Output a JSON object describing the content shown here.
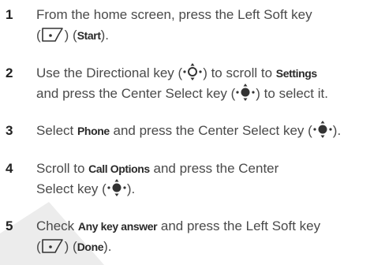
{
  "steps": [
    {
      "number": "1",
      "lines": [
        [
          "From the home screen, press the Left Soft key"
        ],
        [
          "(",
          {
            "icon": "left-soft-key-icon"
          },
          ") (",
          {
            "kw": "Start"
          },
          ")."
        ]
      ]
    },
    {
      "number": "2",
      "lines": [
        [
          "Use the Directional key (",
          {
            "icon": "directional-key-icon"
          },
          ") to scroll to ",
          {
            "kw": "Settings"
          }
        ],
        [
          "and press the Center Select key (",
          {
            "icon": "center-select-key-icon"
          },
          ") to select it."
        ]
      ]
    },
    {
      "number": "3",
      "lines": [
        [
          "Select ",
          {
            "kw": "Phone"
          },
          " and press the Center Select key (",
          {
            "icon": "center-select-key-icon"
          },
          ")."
        ]
      ]
    },
    {
      "number": "4",
      "lines": [
        [
          "Scroll to ",
          {
            "kw": "Call Options"
          },
          " and press the Center"
        ],
        [
          "Select key (",
          {
            "icon": "center-select-key-icon"
          },
          ")."
        ]
      ]
    },
    {
      "number": "5",
      "lines": [
        [
          "Check ",
          {
            "kw": "Any key answer"
          },
          " and press the Left Soft key"
        ],
        [
          "(",
          {
            "icon": "left-soft-key-icon"
          },
          ") (",
          {
            "kw": "Done"
          },
          ")."
        ]
      ]
    }
  ],
  "colors": {
    "text": "#4a4a4a",
    "number": "#222222",
    "wedge": "#e9e9e9"
  }
}
